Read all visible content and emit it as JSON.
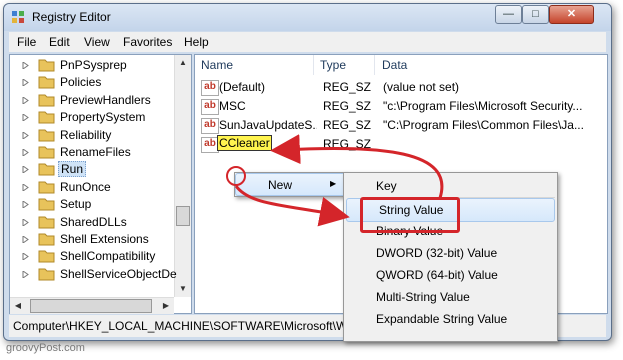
{
  "window": {
    "title": "Registry Editor",
    "min_glyph": "—",
    "max_glyph": "□",
    "close_glyph": "✕"
  },
  "menu": [
    "File",
    "Edit",
    "View",
    "Favorites",
    "Help"
  ],
  "tree": {
    "items": [
      {
        "label": "PnPSysprep",
        "selected": false
      },
      {
        "label": "Policies",
        "selected": false
      },
      {
        "label": "PreviewHandlers",
        "selected": false
      },
      {
        "label": "PropertySystem",
        "selected": false
      },
      {
        "label": "Reliability",
        "selected": false
      },
      {
        "label": "RenameFiles",
        "selected": false
      },
      {
        "label": "Run",
        "selected": true
      },
      {
        "label": "RunOnce",
        "selected": false
      },
      {
        "label": "Setup",
        "selected": false
      },
      {
        "label": "SharedDLLs",
        "selected": false
      },
      {
        "label": "Shell Extensions",
        "selected": false
      },
      {
        "label": "ShellCompatibility",
        "selected": false
      },
      {
        "label": "ShellServiceObjectDe",
        "selected": false
      }
    ]
  },
  "list": {
    "columns": [
      "Name",
      "Type",
      "Data"
    ],
    "rows": [
      {
        "icon": "string-value-icon",
        "name": "(Default)",
        "type": "REG_SZ",
        "data": "(value not set)"
      },
      {
        "icon": "string-value-icon",
        "name": "MSC",
        "type": "REG_SZ",
        "data": "\"c:\\Program Files\\Microsoft Security..."
      },
      {
        "icon": "string-value-icon",
        "name": "SunJavaUpdateS...",
        "type": "REG_SZ",
        "data": "\"C:\\Program Files\\Common Files\\Ja..."
      },
      {
        "icon": "string-value-icon",
        "name": "CCleaner",
        "type": "REG_SZ",
        "data": "",
        "renaming": true
      }
    ],
    "icon_text": "ab"
  },
  "context_menu": {
    "new_label": "New",
    "submenu_arrow": "▶",
    "submenu": [
      "Key",
      "String Value",
      "Binary Value",
      "DWORD (32-bit) Value",
      "QWORD (64-bit) Value",
      "Multi-String Value",
      "Expandable String Value"
    ],
    "highlighted": "String Value"
  },
  "status": {
    "path": "Computer\\HKEY_LOCAL_MACHINE\\SOFTWARE\\Microsoft\\Wir"
  },
  "watermark": "groovyPost.com",
  "colors": {
    "annotation_red": "#d4252a",
    "rename_highlight": "#fff44f",
    "selection": "#cfe3f7",
    "folder": "#e8c35b"
  }
}
